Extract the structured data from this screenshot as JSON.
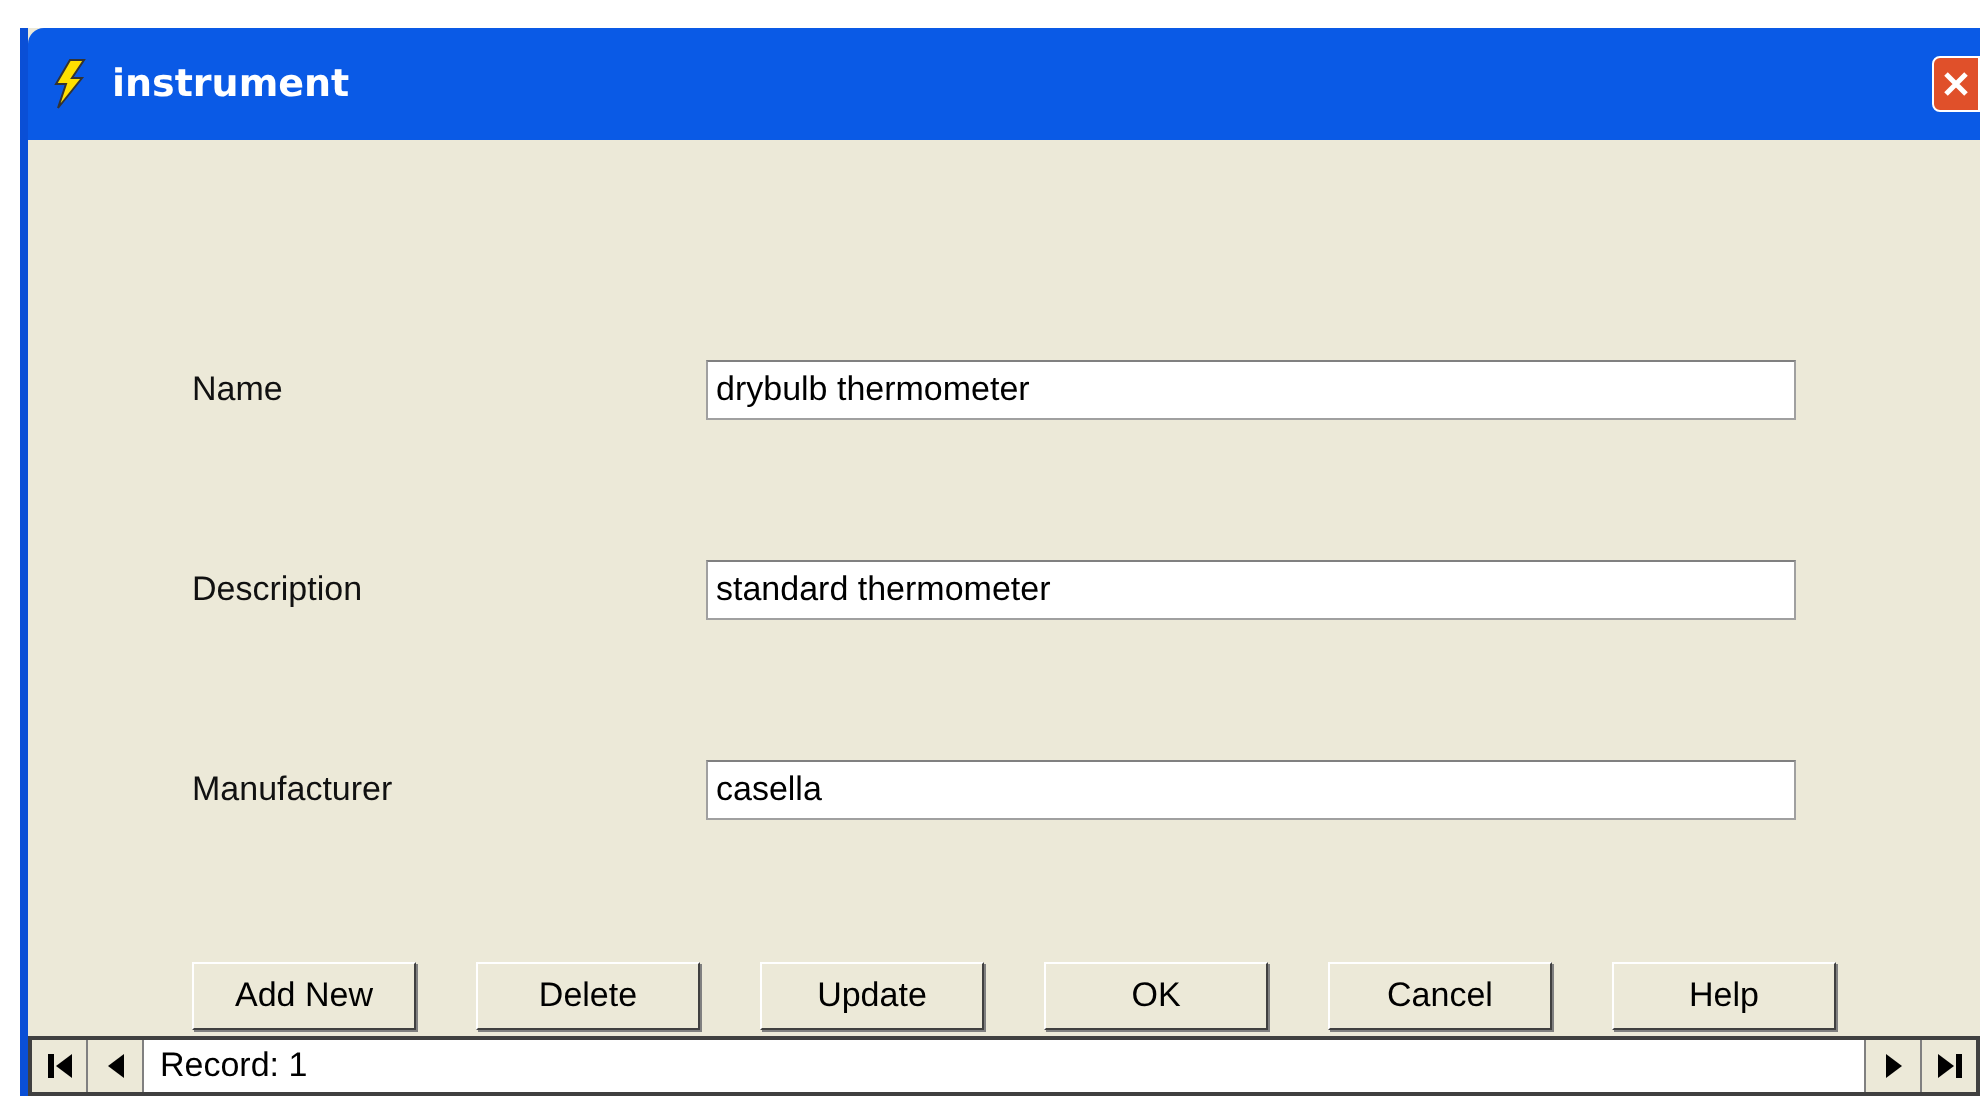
{
  "window": {
    "title": "instrument"
  },
  "fields": [
    {
      "label": "Name",
      "value": "drybulb thermometer"
    },
    {
      "label": "Description",
      "value": "standard thermometer"
    },
    {
      "label": "Manufacturer",
      "value": "casella"
    }
  ],
  "buttons": [
    "Add New",
    "Delete",
    "Update",
    "OK",
    "Cancel",
    "Help"
  ],
  "navigator": {
    "record": "Record: 1"
  }
}
